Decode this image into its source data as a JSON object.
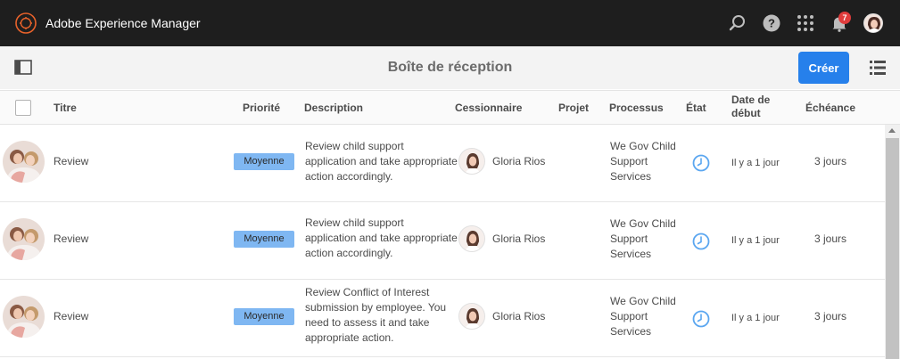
{
  "topbar": {
    "app_title": "Adobe Experience Manager",
    "notification_count": "7",
    "icons": [
      "adobe-logo-icon",
      "search-icon",
      "help-icon",
      "apps-grid-icon",
      "bell-icon",
      "user-avatar"
    ]
  },
  "actionbar": {
    "page_title": "Boîte de réception",
    "create_label": "Créer"
  },
  "table": {
    "headers": {
      "title": "Titre",
      "priority": "Priorité",
      "description": "Description",
      "assignee": "Cessionnaire",
      "project": "Projet",
      "workflow": "Processus",
      "status": "État",
      "start_date_1": "Date de",
      "start_date_2": "début",
      "due": "Échéance"
    },
    "rows": [
      {
        "title": "Review",
        "priority": "Moyenne",
        "desc": [
          "Review child support",
          "application and take appropriate",
          "action accordingly."
        ],
        "assignee": "Gloria Rios",
        "workflow": [
          "We Gov Child",
          "Support",
          "Services"
        ],
        "status_icon": "clock-icon",
        "start": "Il y a 1 jour",
        "due": "3 jours"
      },
      {
        "title": "Review",
        "priority": "Moyenne",
        "desc": [
          "Review child support",
          "application and take appropriate",
          "action accordingly."
        ],
        "assignee": "Gloria Rios",
        "workflow": [
          "We Gov Child",
          "Support",
          "Services"
        ],
        "status_icon": "clock-icon",
        "start": "Il y a 1 jour",
        "due": "3 jours"
      },
      {
        "title": "Review",
        "priority": "Moyenne",
        "desc": [
          "Review Conflict of Interest",
          "submission by employee. You",
          "need to assess it and take",
          "appropriate action."
        ],
        "assignee": "Gloria Rios",
        "workflow": [
          "We Gov Child",
          "Support",
          "Services"
        ],
        "status_icon": "clock-icon",
        "start": "Il y a 1 jour",
        "due": "3 jours"
      }
    ]
  },
  "colors": {
    "topbar": "#1e1e1e",
    "accent": "#2680eb",
    "priority_badge": "#7fb7f2",
    "status_icon": "#5aa6f0"
  }
}
